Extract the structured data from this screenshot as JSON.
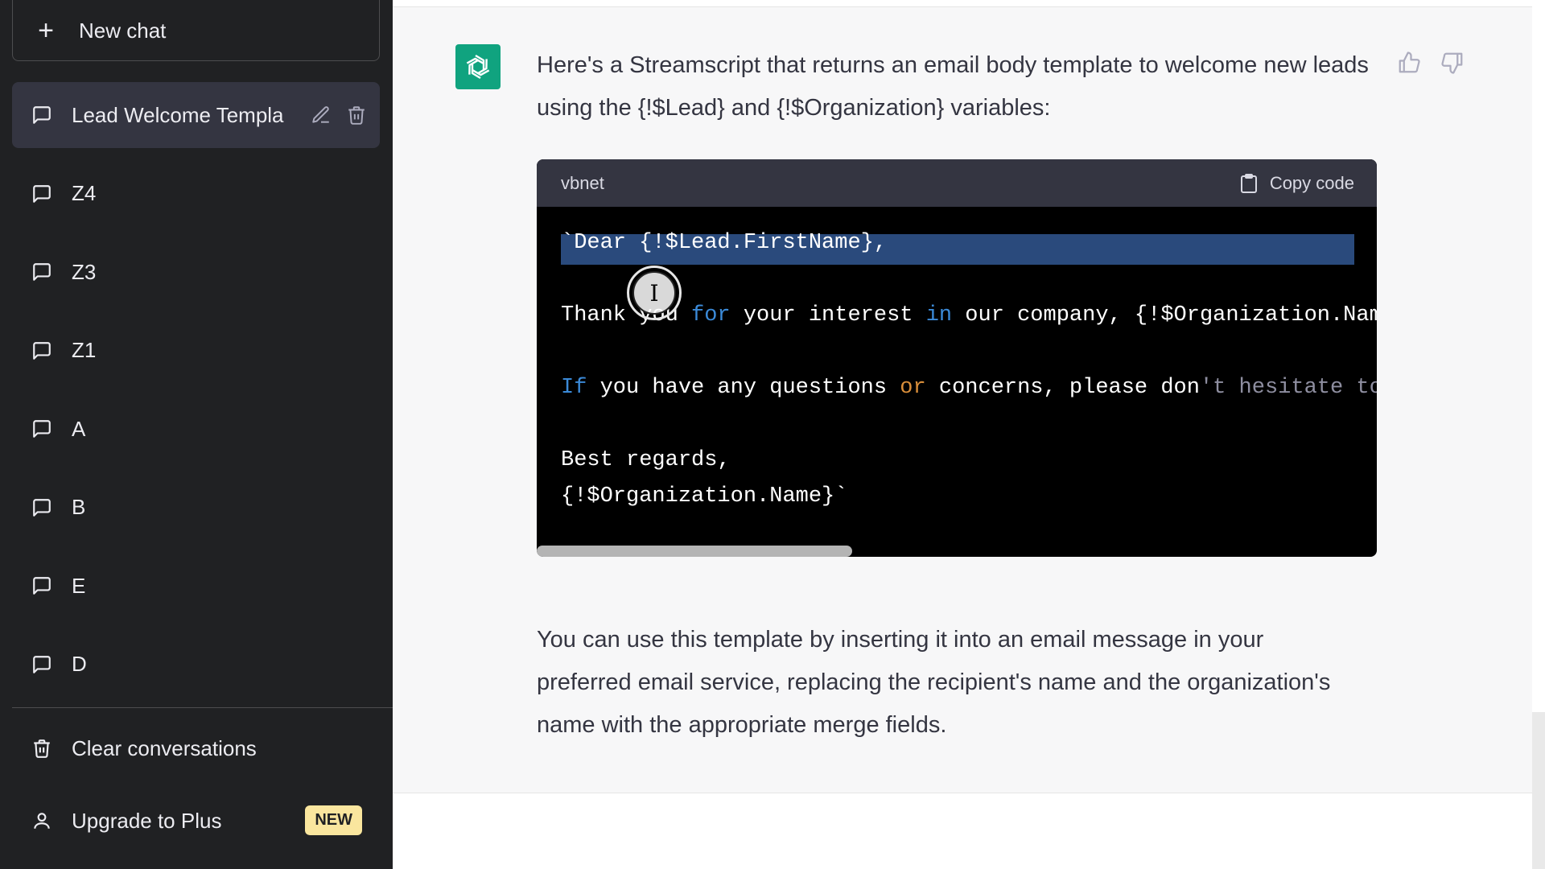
{
  "sidebar": {
    "new_chat_label": "New chat",
    "conversations": [
      {
        "label": "Lead Welcome Templa",
        "active": true
      },
      {
        "label": "Z4"
      },
      {
        "label": "Z3"
      },
      {
        "label": "Z1"
      },
      {
        "label": "A"
      },
      {
        "label": "B"
      },
      {
        "label": "E"
      },
      {
        "label": "D"
      }
    ],
    "clear_label": "Clear conversations",
    "upgrade_label": "Upgrade to Plus",
    "upgrade_badge": "NEW"
  },
  "message": {
    "intro": "Here's a Streamscript that returns an email body template to welcome new leads using the {!$Lead} and {!$Organization} variables:",
    "code": {
      "language": "vbnet",
      "copy_label": "Copy code",
      "line1": "`Dear {!$Lead.FirstName},",
      "line2": {
        "a": "Thank you ",
        "kw1": "for",
        "b": " your interest ",
        "kw2": "in",
        "c": " our company, {!$Organization.Name}"
      },
      "line3": {
        "kw1": "If",
        "a": " you have any questions ",
        "kw2": "or",
        "b": " concerns, please don",
        "c": "'t hesitate to r"
      },
      "line4": "Best regards,",
      "line5": "{!$Organization.Name}`"
    },
    "outro": "You can use this template by inserting it into an email message in your preferred email service, replacing the recipient's name and the organization's name with the appropriate merge fields."
  },
  "colors": {
    "sidebar_bg": "#202123",
    "accent": "#10a37f",
    "badge": "#fae69e",
    "keyword_blue": "#3b8ad8",
    "keyword_orange": "#d98e3a"
  }
}
